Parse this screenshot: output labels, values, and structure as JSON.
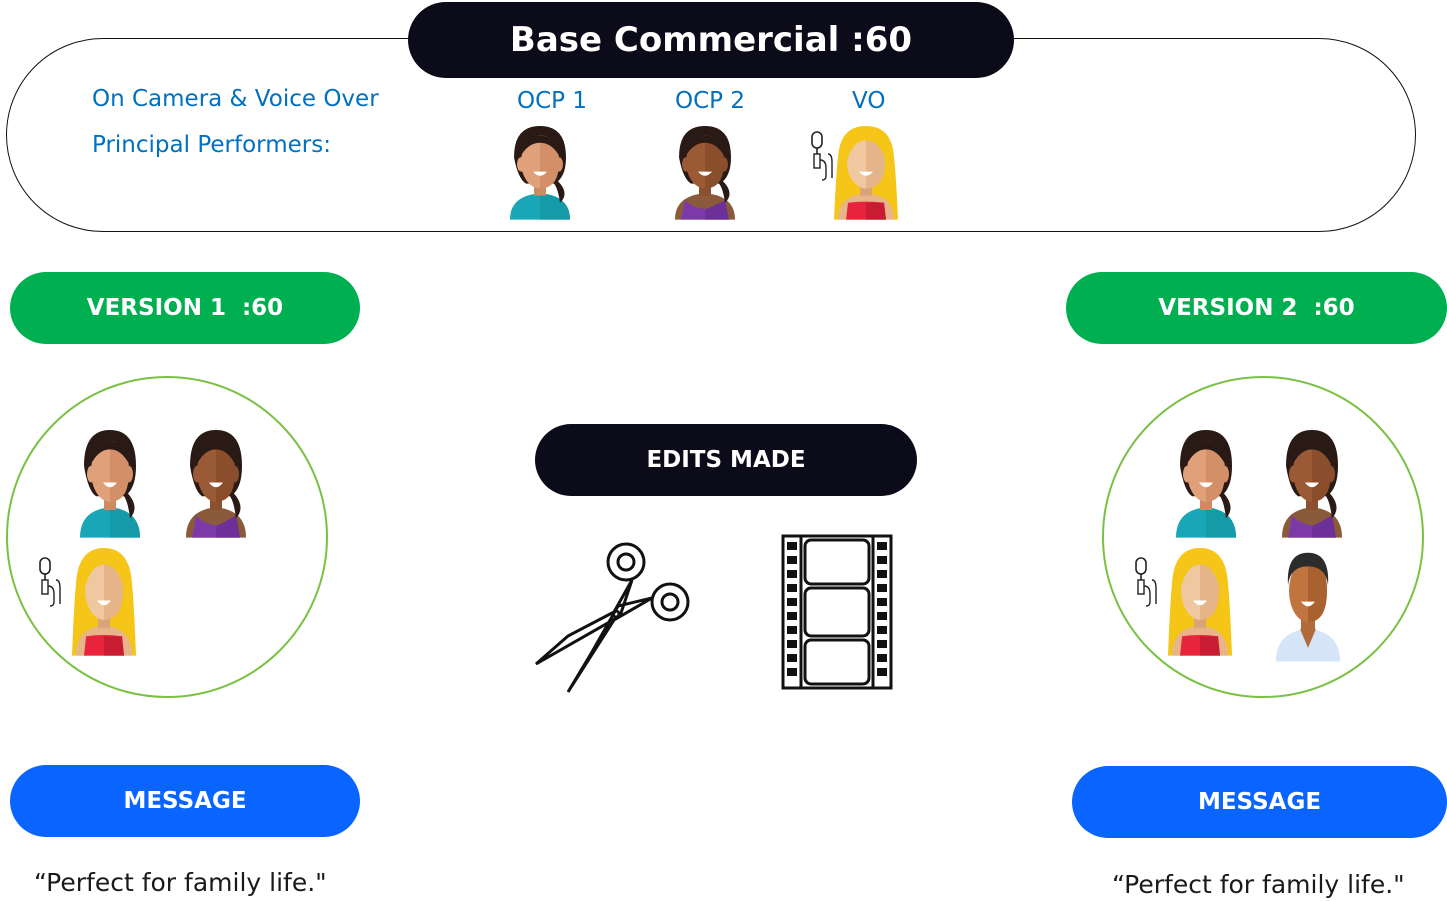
{
  "base": {
    "title": "Base Commercial :60",
    "performers_label_line1": "On Camera & Voice Over",
    "performers_label_line2": "Principal Performers:",
    "ocp1": "OCP 1",
    "ocp2": "OCP 2",
    "vo": "VO"
  },
  "version1": {
    "label": "VERSION 1  :60",
    "message_label": "MESSAGE",
    "message": "“Perfect for family life.\""
  },
  "version2": {
    "label": "VERSION 2  :60",
    "message_label": "MESSAGE",
    "message": "“Perfect for family life.\""
  },
  "edits": {
    "label": "EDITS MADE"
  },
  "colors": {
    "dark_pill": "#0b0b1a",
    "green_pill": "#00b050",
    "blue_pill": "#0a64ff",
    "circle_border": "#7ac143",
    "text_blue": "#0070c0"
  },
  "icons": [
    "woman-teal-icon",
    "woman-purple-icon",
    "woman-blonde-red-icon",
    "microphone-icon",
    "man-icon",
    "scissors-icon",
    "film-strip-icon"
  ]
}
